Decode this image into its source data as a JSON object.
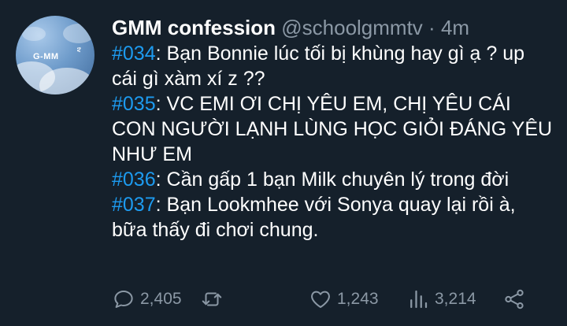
{
  "tweet": {
    "author_name": "GMM confession",
    "handle": "@schoolgmmtv",
    "separator": "·",
    "time": "4m",
    "avatar_logo": "G-MM",
    "avatar_tv": "tv",
    "lines": [
      {
        "tag": "#034",
        "text": ": Bạn Bonnie lúc tối bị khùng hay gì ạ ? up cái gì xàm xí z ??"
      },
      {
        "tag": "#035",
        "text": ": VC EMI ƠI CHỊ YÊU EM, CHỊ YÊU CÁI CON NGƯỜI LẠNH LÙNG HỌC GIỎI ĐÁNG YÊU NHƯ EM"
      },
      {
        "tag": "#036",
        "text": ": Cần gấp 1 bạn Milk chuyên lý trong đời"
      },
      {
        "tag": "#037",
        "text": ": Bạn Lookmhee với Sonya quay lại rồi à, bữa thấy đi chơi chung."
      }
    ]
  },
  "actions": {
    "reply": {
      "icon": "reply-icon",
      "count": "2,405"
    },
    "retweet": {
      "icon": "retweet-icon",
      "count": ""
    },
    "like": {
      "icon": "heart-icon",
      "count": "1,243"
    },
    "views": {
      "icon": "views-icon",
      "count": "3,214"
    },
    "share": {
      "icon": "share-icon"
    }
  },
  "colors": {
    "background": "#15202b",
    "text": "#ffffff",
    "muted": "#8b98a5",
    "hashtag": "#1d9bf0"
  }
}
